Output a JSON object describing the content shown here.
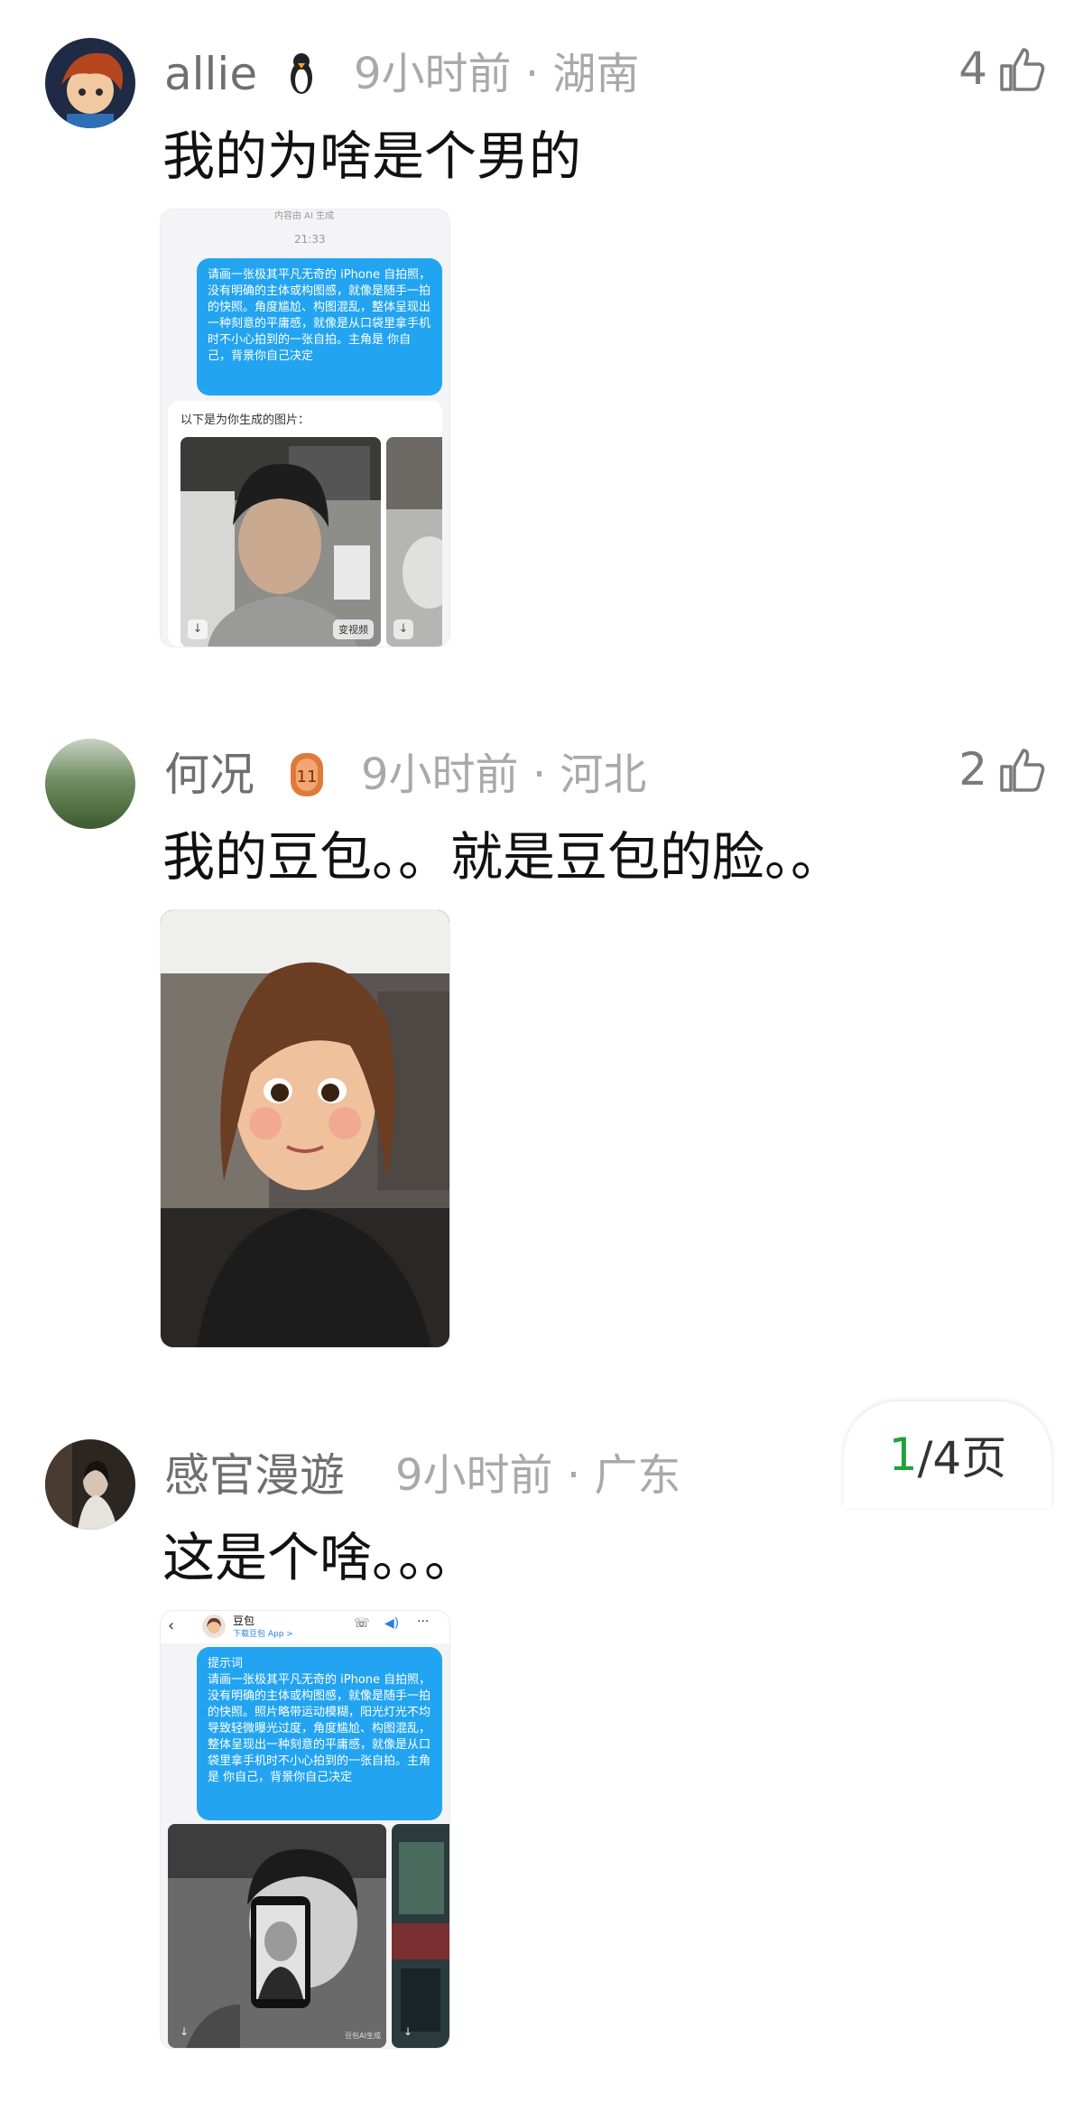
{
  "comments": [
    {
      "username": "allie",
      "time": "9小时前",
      "location": "湖南",
      "likes": "4",
      "text": "我的为啥是个男的",
      "screenshot": {
        "header": "内容由 AI 生成",
        "time": "21:33",
        "prompt": "请画一张极其平凡无奇的 iPhone 自拍照，没有明确的主体或构图感，就像是随手一拍的快照。角度尴尬、构图混乱，整体呈现出一种刻意的平庸感，就像是从口袋里拿手机时不小心拍到的一张自拍。主角是 你自己，背景你自己决定",
        "result_label": "以下是为你生成的图片：",
        "video_button": "变视频"
      }
    },
    {
      "username": "何况",
      "time": "9小时前",
      "location": "河北",
      "likes": "2",
      "text": "我的豆包。。就是豆包的脸。。"
    },
    {
      "username": "感官漫遊",
      "time": "9小时前",
      "location": "广东",
      "text": "这是个啥。。。",
      "screenshot": {
        "bot_name": "豆包",
        "bot_sub": "下载豆包 App >",
        "prompt_title": "提示词",
        "prompt": "请画一张极其平凡无奇的 iPhone 自拍照，没有明确的主体或构图感，就像是随手一拍的快照。照片略带运动模糊，阳光灯光不均导致轻微曝光过度，角度尴尬、构图混乱，整体呈现出一种刻意的平庸感，就像是从口袋里拿手机时不小心拍到的一张自拍。主角是 你自己，背景你自己决定",
        "watermark": "豆包AI生成"
      }
    }
  ],
  "separator": "·",
  "pager": {
    "current": "1",
    "rest": "/4页"
  },
  "colors": {
    "accent_green": "#1ea23a",
    "bubble_blue": "#23a4f0",
    "meta_gray": "#a9a9a9"
  }
}
